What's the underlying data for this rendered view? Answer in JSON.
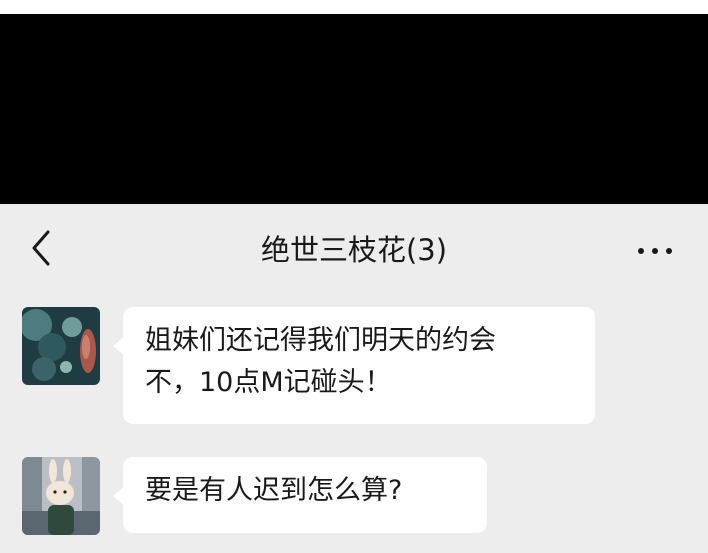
{
  "header": {
    "title": "绝世三枝花(3)",
    "back_icon": "chevron-left-icon",
    "more_icon": "ellipsis-icon"
  },
  "messages": [
    {
      "lines": [
        "姐妹们还记得我们明天的约会",
        "不，10点M记碰头！"
      ]
    },
    {
      "lines": [
        "要是有人迟到怎么算?"
      ]
    }
  ],
  "colors": {
    "background": "#ededed",
    "bubble": "#ffffff",
    "text": "#191919",
    "top_block": "#000000"
  }
}
